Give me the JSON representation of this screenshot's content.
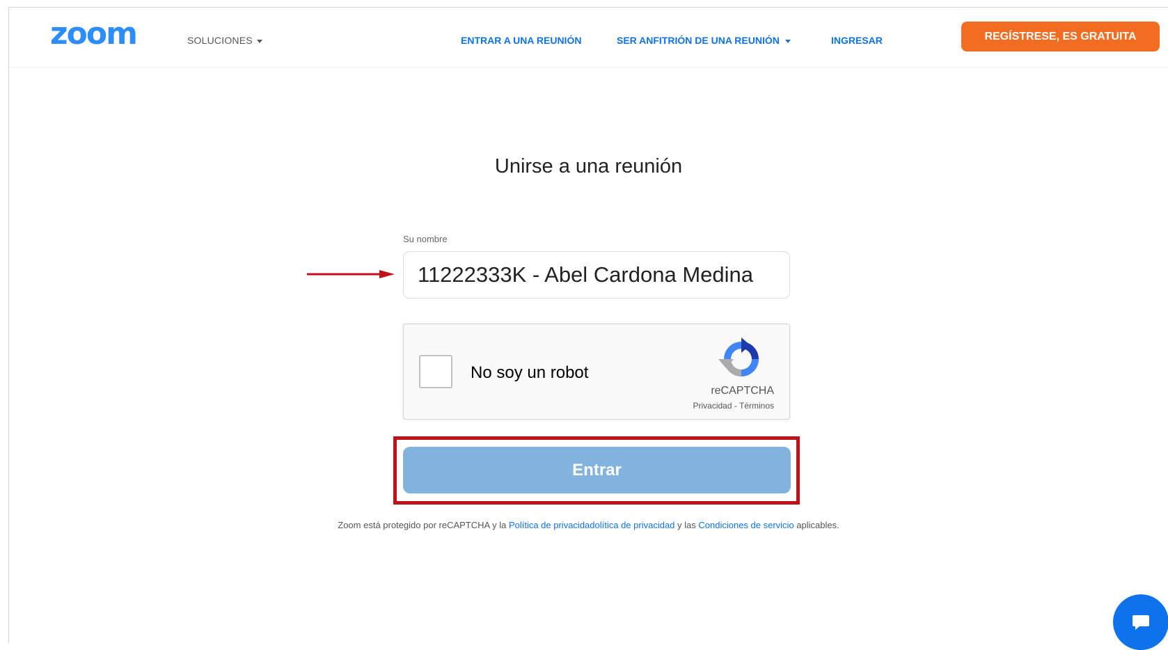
{
  "header": {
    "logo": "zoom",
    "solutions_label": "SOLUCIONES",
    "join_label": "ENTRAR A UNA REUNIÓN",
    "host_label": "SER ANFITRIÓN DE UNA REUNIÓN",
    "signin_label": "INGRESAR",
    "signup_label": "REGÍSTRESE, ES GRATUITA"
  },
  "main": {
    "title": "Unirse a una reunión",
    "name_label": "Su nombre",
    "name_value": "11222333K - Abel Cardona Medina",
    "captcha": {
      "checkbox_label": "No soy un robot",
      "brand": "reCAPTCHA",
      "privacy": "Privacidad",
      "separator": " - ",
      "terms": "Términos"
    },
    "enter_label": "Entrar",
    "legal": {
      "prefix": "Zoom está protegido por reCAPTCHA y la ",
      "privacy_link": "Política de privacidadolítica de privacidad",
      "middle": " y las ",
      "terms_link": "Condiciones de servicio",
      "suffix": " aplicables."
    }
  },
  "colors": {
    "brand_blue": "#2d8cff",
    "link_blue": "#0e72ed",
    "signup_orange": "#f26d21",
    "enter_button": "#82b3de",
    "annotation_red": "#c0121b"
  },
  "icons": {
    "annotation_arrow": "arrow-right-icon",
    "chat": "chat-bubble-icon",
    "captcha_logo": "recaptcha-logo-icon"
  }
}
